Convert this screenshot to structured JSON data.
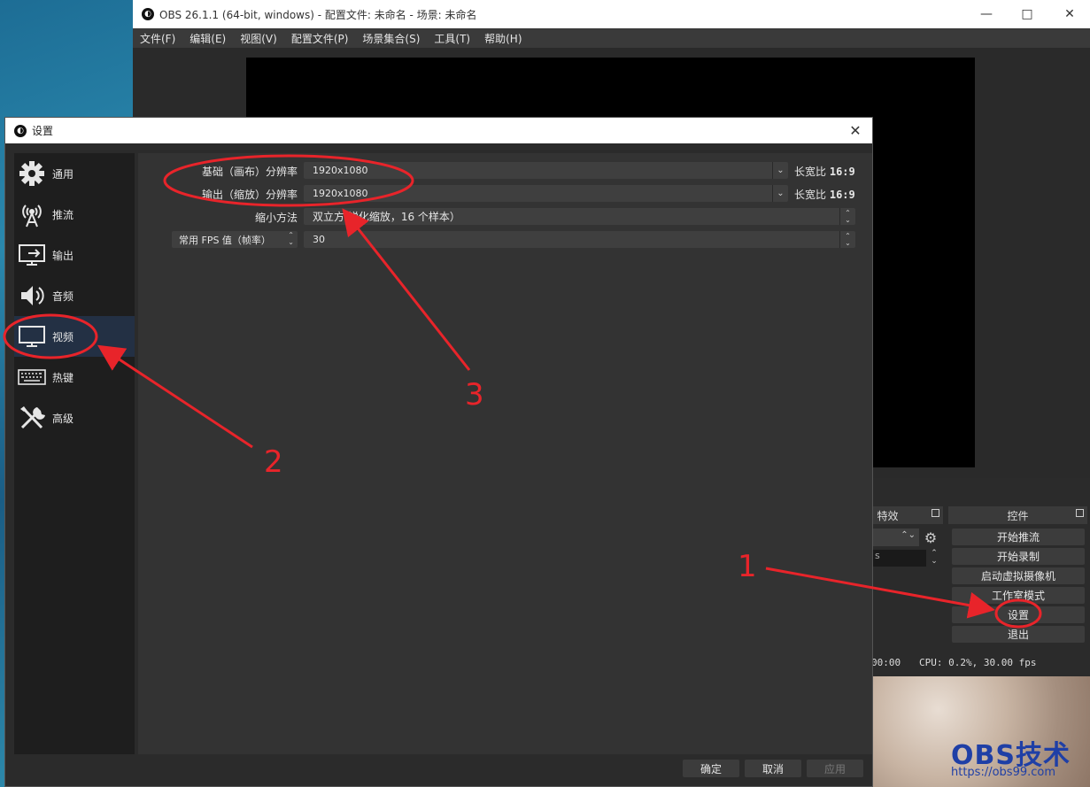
{
  "main_window": {
    "title": "OBS 26.1.1 (64-bit, windows) - 配置文件: 未命名 - 场景: 未命名",
    "menus": [
      "文件(F)",
      "编辑(E)",
      "视图(V)",
      "配置文件(P)",
      "场景集合(S)",
      "工具(T)",
      "帮助(H)"
    ],
    "docks": {
      "effects_label_partial": "特效",
      "controls_label": "控件"
    },
    "controls": [
      "开始推流",
      "开始录制",
      "启动虚拟摄像机",
      "工作室模式",
      "设置",
      "退出"
    ],
    "status": {
      "time_partial": "00:00",
      "cpu": "CPU: 0.2%, 30.00 fps"
    }
  },
  "settings_dialog": {
    "title": "设置",
    "sidebar": [
      {
        "label": "通用",
        "icon": "gear-icon"
      },
      {
        "label": "推流",
        "icon": "broadcast-antenna-icon"
      },
      {
        "label": "输出",
        "icon": "output-monitor-icon"
      },
      {
        "label": "音频",
        "icon": "speaker-icon"
      },
      {
        "label": "视频",
        "icon": "monitor-icon",
        "active": true
      },
      {
        "label": "热键",
        "icon": "keyboard-icon"
      },
      {
        "label": "高级",
        "icon": "tools-icon"
      }
    ],
    "video": {
      "base_res_label": "基础（画布）分辨率",
      "base_res_value": "1920x1080",
      "base_aspect_label": "长宽比",
      "base_aspect_value": "16:9",
      "output_res_label": "输出（缩放）分辨率",
      "output_res_value": "1920x1080",
      "output_aspect_label": "长宽比",
      "output_aspect_value": "16:9",
      "downscale_label": "缩小方法",
      "downscale_value": "双立方 锐化缩放，16 个样本）",
      "fps_label": "常用 FPS 值（帧率）",
      "fps_value": "30"
    },
    "buttons": {
      "ok": "确定",
      "cancel": "取消",
      "apply": "应用"
    }
  },
  "annotations": {
    "step1": "1",
    "step2": "2",
    "step3": "3",
    "color": "#e8242a"
  },
  "watermark": {
    "brand": "OBS技术",
    "url": "https://obs99.com"
  }
}
